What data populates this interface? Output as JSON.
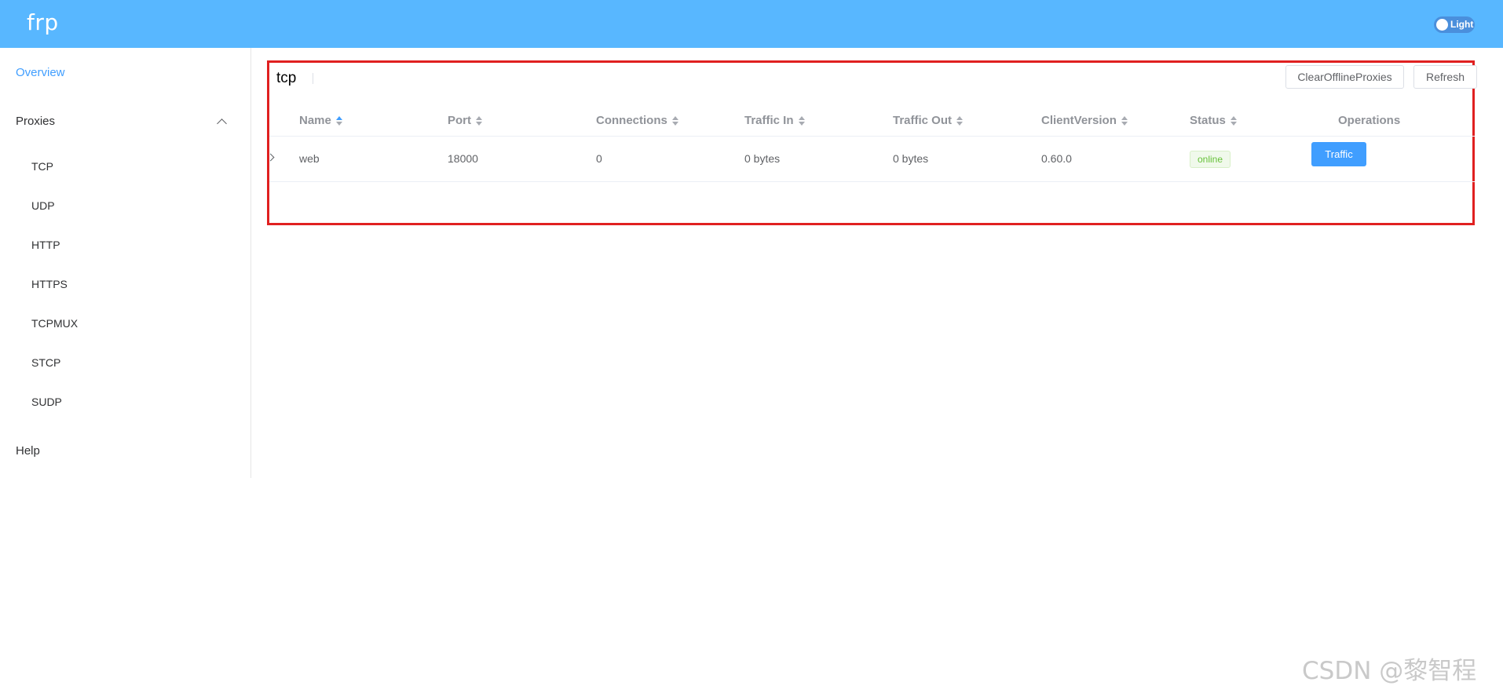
{
  "app": {
    "logo": "frp"
  },
  "theme": {
    "label": "Light"
  },
  "sidebar": {
    "overview": "Overview",
    "proxies": "Proxies",
    "items": [
      "TCP",
      "UDP",
      "HTTP",
      "HTTPS",
      "TCPMUX",
      "STCP",
      "SUDP"
    ],
    "help": "Help"
  },
  "panel": {
    "title": "tcp",
    "clear_label": "ClearOfflineProxies",
    "refresh_label": "Refresh"
  },
  "table": {
    "columns": [
      "Name",
      "Port",
      "Connections",
      "Traffic In",
      "Traffic Out",
      "ClientVersion",
      "Status",
      "Operations"
    ],
    "rows": [
      {
        "name": "web",
        "port": "18000",
        "connections": "0",
        "traffic_in": "0 bytes",
        "traffic_out": "0 bytes",
        "client_version": "0.60.0",
        "status": "online",
        "operation": "Traffic"
      }
    ]
  },
  "colors": {
    "header": "#58b7ff",
    "accent": "#409eff",
    "highlight_border": "#e02020",
    "online": "#67c23a"
  },
  "watermark": "CSDN @黎智程"
}
